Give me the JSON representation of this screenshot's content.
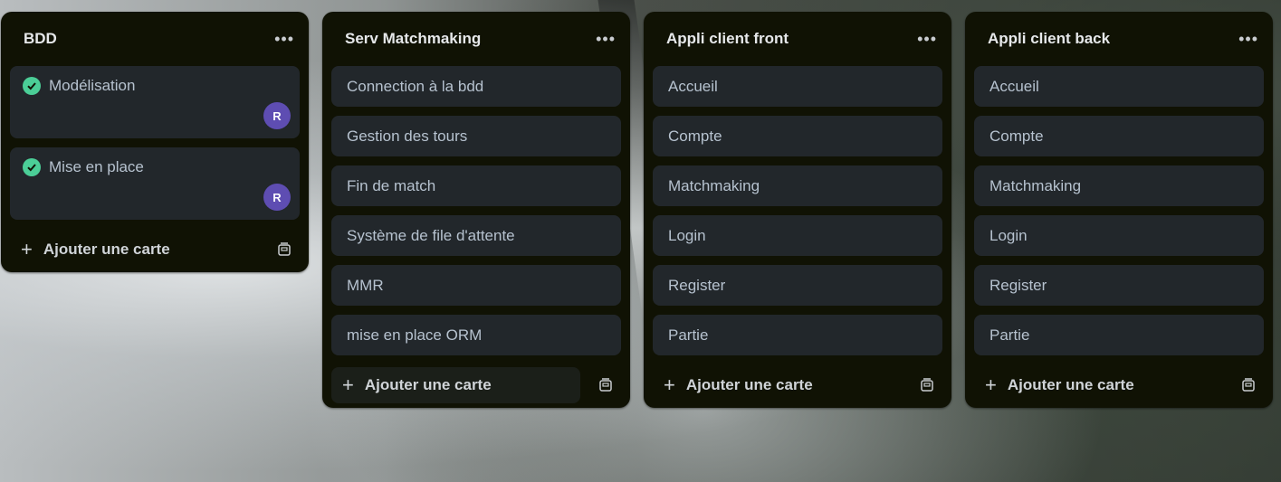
{
  "lists": [
    {
      "title": "BDD",
      "menu_icon": "ellipsis-icon",
      "cards": [
        {
          "label": "Modélisation",
          "done": true,
          "member": "R"
        },
        {
          "label": "Mise en place",
          "done": true,
          "member": "R"
        }
      ],
      "add_label": "Ajouter une carte"
    },
    {
      "title": "Serv Matchmaking",
      "menu_icon": "ellipsis-icon",
      "cards": [
        {
          "label": "Connection à la bdd"
        },
        {
          "label": "Gestion des tours"
        },
        {
          "label": "Fin de match"
        },
        {
          "label": "Système de file d'attente"
        },
        {
          "label": "MMR"
        },
        {
          "label": "mise en place ORM"
        }
      ],
      "add_label": "Ajouter une carte"
    },
    {
      "title": "Appli client front",
      "menu_icon": "ellipsis-icon",
      "cards": [
        {
          "label": "Accueil"
        },
        {
          "label": "Compte"
        },
        {
          "label": "Matchmaking"
        },
        {
          "label": "Login"
        },
        {
          "label": "Register"
        },
        {
          "label": "Partie"
        }
      ],
      "add_label": "Ajouter une carte"
    },
    {
      "title": "Appli client back",
      "menu_icon": "ellipsis-icon",
      "cards": [
        {
          "label": "Accueil"
        },
        {
          "label": "Compte"
        },
        {
          "label": "Matchmaking"
        },
        {
          "label": "Login"
        },
        {
          "label": "Register"
        },
        {
          "label": "Partie"
        }
      ],
      "add_label": "Ajouter une carte"
    }
  ],
  "colors": {
    "list_bg": "#101204",
    "card_bg": "#22272b",
    "check_green": "#4bce97",
    "avatar_purple": "#5e4db2"
  }
}
